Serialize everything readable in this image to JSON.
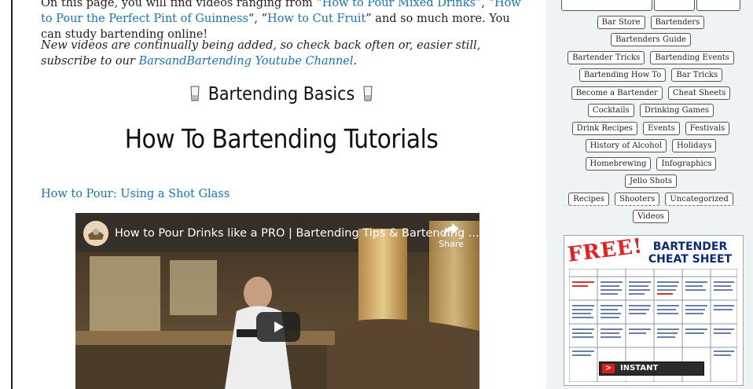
{
  "article": {
    "intro_prefix": "On this page, you will find videos ranging from “",
    "link_mixed_drinks": "How to Pour Mixed Drinks",
    "intro_sep1": "”, “",
    "link_guinness": "How to Pour the Perfect Pint of Guinness",
    "intro_sep2": "“, “",
    "link_cut_fruit": "How to Cut Fruit",
    "intro_suffix": "” and so much more. You can study bartending online!",
    "para2_text": "New videos are continually being added, so check back often or, easier still, subscribe to our ",
    "para2_link": "BarsandBartending Youtube Channel",
    "para2_end": ".",
    "subtitle": "Bartending Basics",
    "title": "How To Bartending Tutorials",
    "section_link": "How to Pour: Using a Shot Glass"
  },
  "video": {
    "title": "How to Pour Drinks like a PRO | Bartending Tips & Bartending ...",
    "share_label": "Share",
    "icons": [
      "share-arrow-icon",
      "play-icon",
      "shot-glass-icon"
    ]
  },
  "sidebar": {
    "tags": [
      "Bar Store",
      "Bartenders",
      "Bartenders Guide",
      "Bartender Tricks",
      "Bartending Events",
      "Bartending How To",
      "Bar Tricks",
      "Become a Bartender",
      "Cheat Sheets",
      "Cocktails",
      "Drinking Games",
      "Drink Recipes",
      "Events",
      "Festivals",
      "History of Alcohol",
      "Holidays",
      "Homebrewing",
      "Infographics",
      "Jello Shots",
      "Recipes",
      "Shooters",
      "Uncategorized",
      "Videos"
    ],
    "ad": {
      "free_label": "FREE",
      "exclaim": "!",
      "headline_line1": "BARTENDER",
      "headline_line2": "CHEAT SHEET",
      "button_label": "INSTANT DOWNLOAD!",
      "button_arrow": ">"
    }
  },
  "colors": {
    "link": "#1a73b8",
    "sidebar_bg": "#eef4f6",
    "ad_red": "#e62020",
    "ad_blue": "#0b2a7a"
  }
}
